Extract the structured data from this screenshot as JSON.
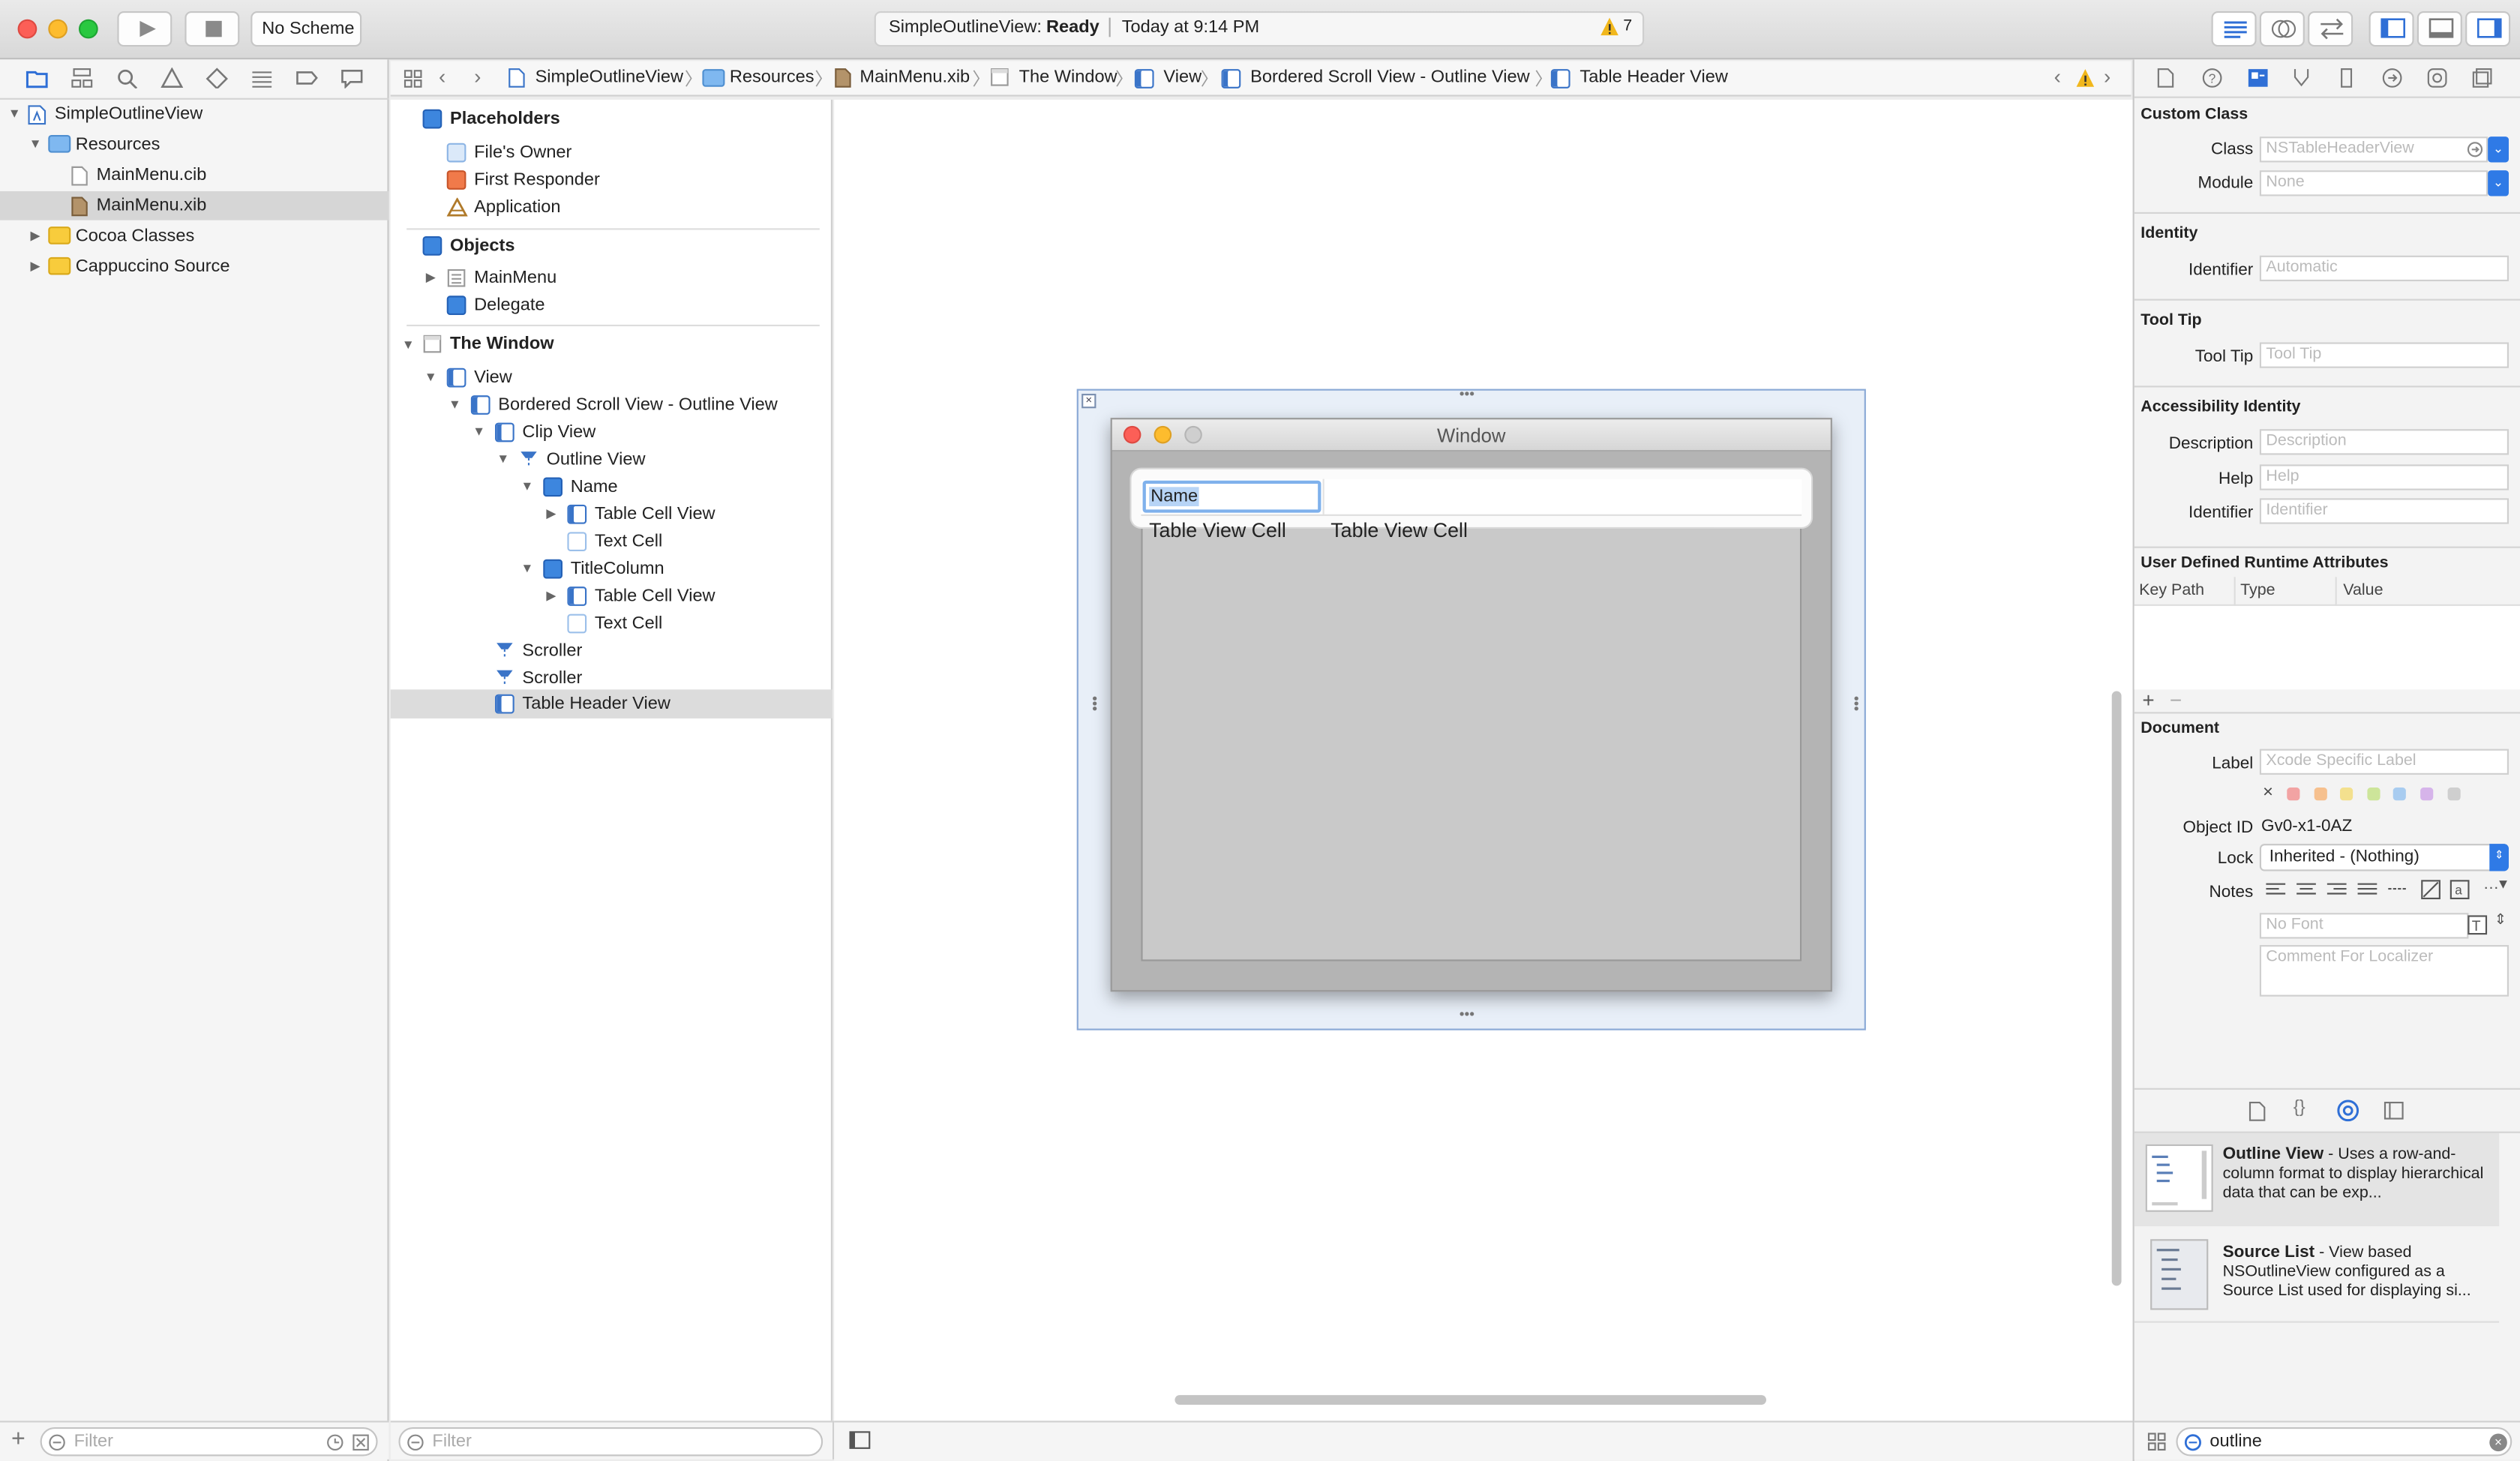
{
  "toolbar": {
    "scheme": "No Scheme",
    "activity_project": "SimpleOutlineView:",
    "activity_status": "Ready",
    "activity_time": "Today at 9:14 PM",
    "warning_count": "7"
  },
  "jumpbar": {
    "items": [
      "SimpleOutlineView",
      "Resources",
      "MainMenu.xib",
      "The Window",
      "View",
      "Bordered Scroll View - Outline View",
      "Table Header View"
    ]
  },
  "navigator": {
    "project": "SimpleOutlineView",
    "items": [
      {
        "label": "Resources"
      },
      {
        "label": "MainMenu.cib"
      },
      {
        "label": "MainMenu.xib"
      },
      {
        "label": "Cocoa Classes"
      },
      {
        "label": "Cappuccino Source"
      }
    ],
    "filter_placeholder": "Filter"
  },
  "outline": {
    "placeholders_title": "Placeholders",
    "placeholders": [
      "File's Owner",
      "First Responder",
      "Application"
    ],
    "objects_title": "Objects",
    "objects": [
      "MainMenu",
      "Delegate"
    ],
    "window_title": "The Window",
    "tree": [
      "View",
      "Bordered Scroll View - Outline View",
      "Clip View",
      "Outline View",
      "Name",
      "Table Cell View",
      "Text Cell",
      "TitleColumn",
      "Table Cell View",
      "Text Cell",
      "Scroller",
      "Scroller",
      "Table Header View"
    ],
    "filter_placeholder": "Filter"
  },
  "canvas": {
    "window_title": "Window",
    "header_name": "Name",
    "cell1": "Table View Cell",
    "cell2": "Table View Cell"
  },
  "inspector": {
    "custom_class_title": "Custom Class",
    "class_label": "Class",
    "class_placeholder": "NSTableHeaderView",
    "module_label": "Module",
    "module_placeholder": "None",
    "identity_title": "Identity",
    "identifier_label": "Identifier",
    "identifier_placeholder": "Automatic",
    "tooltip_title": "Tool Tip",
    "tooltip_label": "Tool Tip",
    "tooltip_placeholder": "Tool Tip",
    "acc_title": "Accessibility Identity",
    "description_label": "Description",
    "description_placeholder": "Description",
    "help_label": "Help",
    "help_placeholder": "Help",
    "acc_identifier_label": "Identifier",
    "acc_identifier_placeholder": "Identifier",
    "udra_title": "User Defined Runtime Attributes",
    "col_keypath": "Key Path",
    "col_type": "Type",
    "col_value": "Value",
    "document_title": "Document",
    "doc_label_label": "Label",
    "doc_label_placeholder": "Xcode Specific Label",
    "objectid_label": "Object ID",
    "objectid_value": "Gv0-x1-0AZ",
    "lock_label": "Lock",
    "lock_value": "Inherited - (Nothing)",
    "notes_label": "Notes",
    "font_placeholder": "No Font",
    "comment_placeholder": "Comment For Localizer",
    "label_colors": [
      "#f2a3a3",
      "#f6c08e",
      "#f3e08e",
      "#cde59a",
      "#a8ccf0",
      "#d6b4ea",
      "#cfcfcf"
    ]
  },
  "library": {
    "items": [
      {
        "title": "Outline View",
        "desc": " - Uses a row-and-column format to display hierarchical data that can be exp..."
      },
      {
        "title": "Source List",
        "desc": " - View based NSOutlineView configured as a Source List used for displaying si..."
      }
    ],
    "search_value": "outline"
  }
}
